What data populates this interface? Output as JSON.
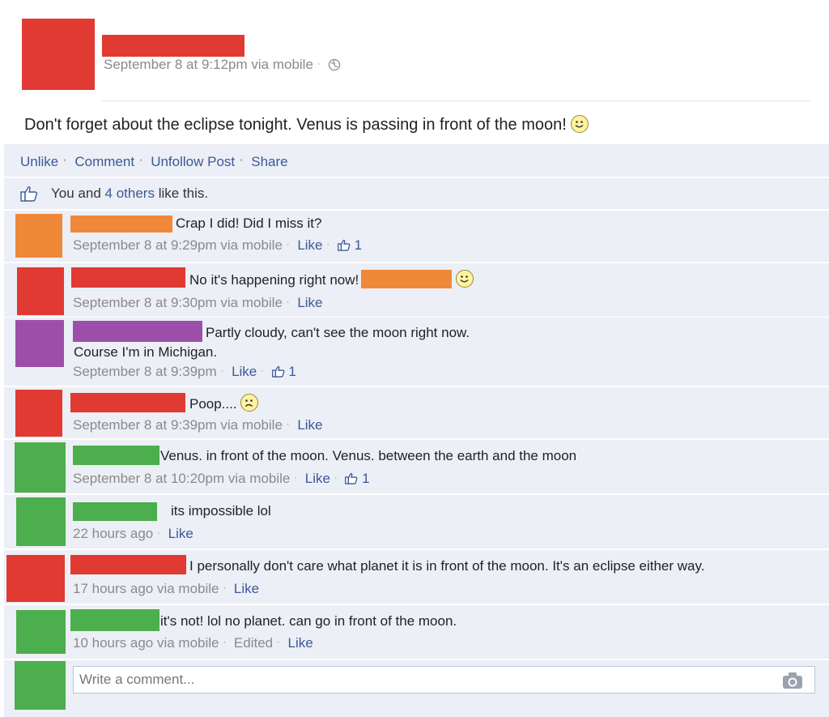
{
  "colors": {
    "red": "#e03a33",
    "orange": "#f0883a",
    "purple": "#9c4fa8",
    "green": "#4cae4c",
    "link": "#3b5998",
    "bar_bg": "#eceff5"
  },
  "post": {
    "timestamp": "September 8 at 9:12pm via mobile",
    "audience_icon": "globe-icon",
    "text": "Don't forget about the eclipse tonight. Venus is passing in front of the moon!"
  },
  "actions": {
    "unlike": "Unlike",
    "comment": "Comment",
    "unfollow": "Unfollow Post",
    "share": "Share"
  },
  "likes": {
    "prefix": "You and",
    "others": "4 others",
    "suffix": "like this."
  },
  "comments": [
    {
      "text": "Crap I did! Did I miss it?",
      "meta": "September 8 at 9:29pm via mobile",
      "like": "Like",
      "likes_count": "1"
    },
    {
      "text": "No it's happening right now!",
      "meta": "September 8 at 9:30pm via mobile",
      "like": "Like"
    },
    {
      "text": "Partly cloudy, can't see the moon right now.",
      "text2": "Course I'm in Michigan.",
      "meta": "September 8 at 9:39pm",
      "like": "Like",
      "likes_count": "1"
    },
    {
      "text": "Poop....",
      "meta": "September 8 at 9:39pm via mobile",
      "like": "Like"
    },
    {
      "text": "Venus. in front of the moon. Venus. between the earth and the moon",
      "meta": "September 8 at 10:20pm via mobile",
      "like": "Like",
      "likes_count": "1"
    },
    {
      "text": "its impossible lol",
      "meta": "22 hours ago",
      "like": "Like"
    },
    {
      "text": "I personally don't care what planet it is in front of the moon. It's an eclipse either way.",
      "meta": "17 hours ago via mobile",
      "like": "Like"
    },
    {
      "text": "it's not! lol no planet. can go in front of the moon.",
      "meta": "10 hours ago via mobile",
      "edited": "Edited",
      "like": "Like"
    }
  ],
  "composer": {
    "placeholder": "Write a comment..."
  }
}
